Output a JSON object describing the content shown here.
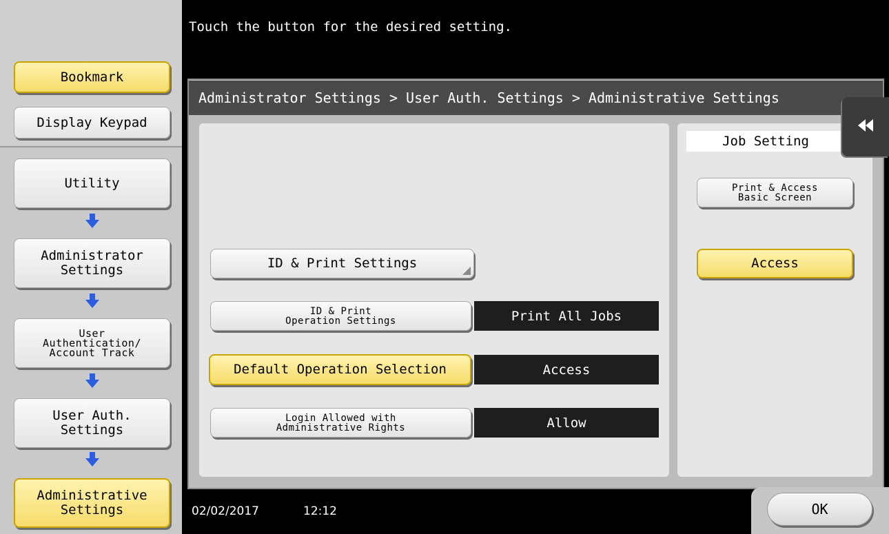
{
  "header": {
    "message": "Touch the button for the desired setting."
  },
  "sidebar": {
    "bookmark_label": "Bookmark",
    "display_keypad_label": "Display Keypad",
    "nav": [
      {
        "label": "Utility"
      },
      {
        "label": "Administrator\nSettings"
      },
      {
        "label": "User\nAuthentication/\nAccount Track"
      },
      {
        "label": "User Auth.\nSettings"
      },
      {
        "label": "Administrative\nSettings"
      }
    ]
  },
  "breadcrumb": "Administrator Settings > User Auth. Settings > Administrative Settings",
  "settings": {
    "id_print_settings_label": "ID & Print Settings",
    "rows": [
      {
        "label": "ID & Print\nOperation Settings",
        "value": "Print All Jobs"
      },
      {
        "label": "Default Operation Selection",
        "value": "Access"
      },
      {
        "label": "Login Allowed with\nAdministrative Rights",
        "value": "Allow"
      }
    ]
  },
  "job_setting": {
    "title": "Job Setting",
    "print_access_label": "Print & Access\nBasic Screen",
    "access_label": "Access"
  },
  "footer": {
    "date": "02/02/2017",
    "time": "12:12",
    "ok_label": "OK"
  },
  "colors": {
    "accent_yellow": "#f6dc6a",
    "arrow_blue": "#2a5de0",
    "value_bg": "#1e1e1e"
  },
  "icons": {
    "flow_arrow": "arrow-down-icon",
    "collapse": "double-left-arrow-icon"
  }
}
